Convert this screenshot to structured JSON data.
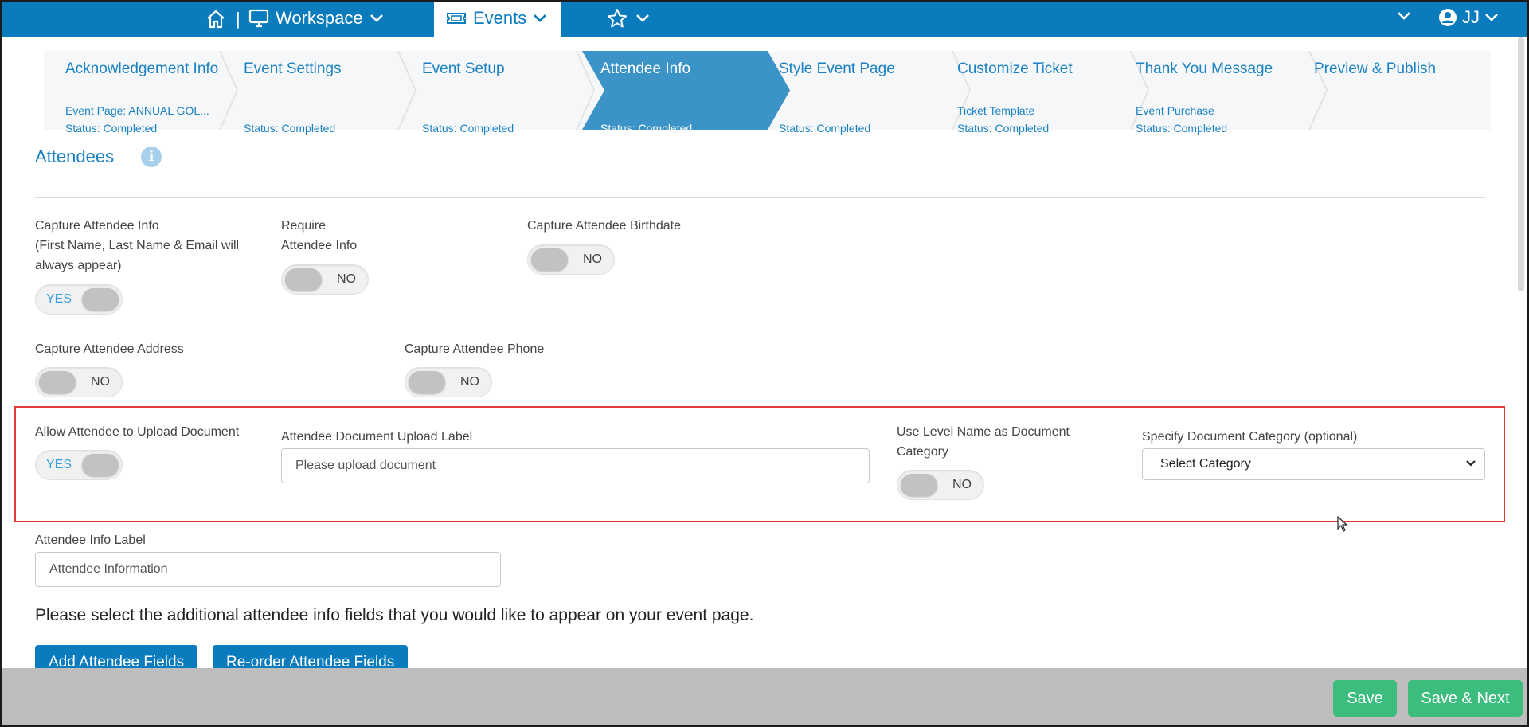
{
  "nav": {
    "separator": "|",
    "workspace_label": "Workspace",
    "events_label": "Events",
    "user_initials": "JJ",
    "brand_color": "#0a7bbd"
  },
  "steps": [
    {
      "name": "Acknowledgement Info",
      "sub1": "Event Page: ANNUAL GOL...",
      "sub2": "Status: Completed"
    },
    {
      "name": "Event Settings",
      "sub1": "",
      "sub2": "Status: Completed"
    },
    {
      "name": "Event Setup",
      "sub1": "",
      "sub2": "Status: Completed"
    },
    {
      "name": "Attendee Info",
      "sub1": "",
      "sub2": "Status: Completed",
      "active": true
    },
    {
      "name": "Style Event Page",
      "sub1": "",
      "sub2": "Status: Completed"
    },
    {
      "name": "Customize Ticket",
      "sub1": "Ticket Template",
      "sub2": "Status: Completed"
    },
    {
      "name": "Thank You Message",
      "sub1": "Event Purchase",
      "sub2": "Status: Completed"
    },
    {
      "name": "Preview & Publish",
      "sub1": "",
      "sub2": ""
    }
  ],
  "section": {
    "title": "Attendees"
  },
  "fields": {
    "capture_info": {
      "l1": "Capture Attendee Info",
      "l2": "(First Name, Last Name & Email will",
      "l3": "always appear)",
      "value": "YES"
    },
    "require_info": {
      "l1": "Require",
      "l2": "Attendee Info",
      "value": "NO"
    },
    "capture_birthdate": {
      "label": "Capture Attendee Birthdate",
      "value": "NO"
    },
    "capture_address": {
      "label": "Capture Attendee Address",
      "value": "NO"
    },
    "capture_phone": {
      "label": "Capture Attendee Phone",
      "value": "NO"
    },
    "allow_upload": {
      "label": "Allow Attendee to Upload Document",
      "value": "YES"
    },
    "upload_label": {
      "label": "Attendee Document Upload Label",
      "placeholder": "Please upload document"
    },
    "use_level_name": {
      "l1": "Use Level Name as Document",
      "l2": "Category",
      "value": "NO"
    },
    "doc_category": {
      "label": "Specify Document Category (optional)",
      "value": "Select Category"
    },
    "attendee_info_label": {
      "label": "Attendee Info Label",
      "placeholder": "Attendee Information"
    }
  },
  "instructions": "Please select the additional attendee info fields that you would like to appear on your event page.",
  "buttons": {
    "add_fields": "Add Attendee Fields",
    "reorder_fields": "Re-order Attendee Fields",
    "save": "Save",
    "save_next": "Save & Next"
  },
  "colors": {
    "accent": "#1a82c4",
    "active_step": "#3b93c8",
    "success": "#3dbd7d",
    "highlight": "#e03b3b"
  }
}
